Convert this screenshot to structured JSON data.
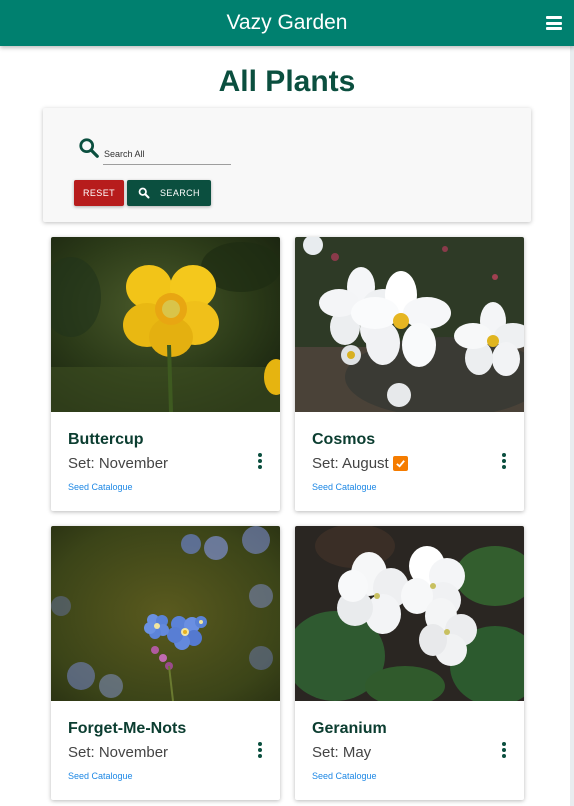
{
  "app": {
    "brand": "Vazy Garden"
  },
  "page": {
    "title": "All Plants"
  },
  "search": {
    "placeholder": "Search All",
    "reset_label": "RESET",
    "search_label": "SEARCH"
  },
  "plants": [
    {
      "name": "Buttercup",
      "set_label": "Set: November",
      "link": "Seed Catalogue",
      "checked": false
    },
    {
      "name": "Cosmos",
      "set_label": "Set: August",
      "link": "Seed Catalogue",
      "checked": true
    },
    {
      "name": "Forget-Me-Nots",
      "set_label": "Set: November",
      "link": "Seed Catalogue",
      "checked": false
    },
    {
      "name": "Geranium",
      "set_label": "Set: May",
      "link": "Seed Catalogue",
      "checked": false
    }
  ],
  "colors": {
    "navbar": "#00806f",
    "title": "#0b4f3f",
    "reset": "#b71c1c",
    "search": "#0b4f3f",
    "check": "#f57c00",
    "link": "#1e88e5"
  },
  "icons": {
    "menu": "hamburger-icon",
    "search": "search-icon",
    "more": "more-vert-icon",
    "check": "check-box-icon"
  }
}
